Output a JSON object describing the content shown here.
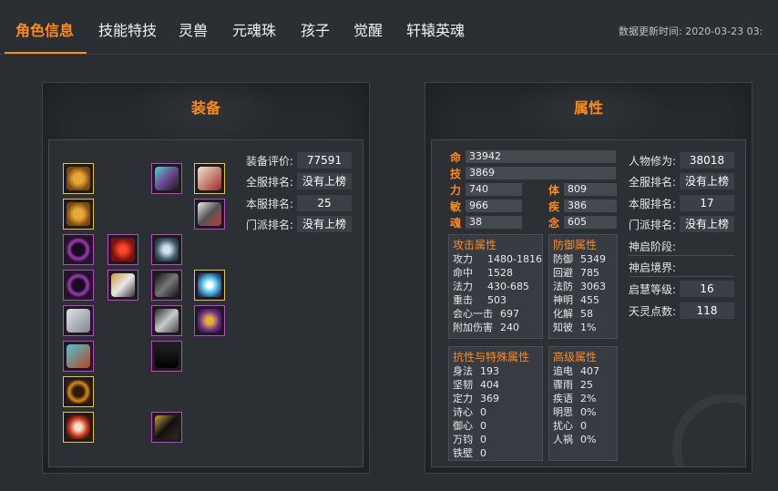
{
  "nav": {
    "tabs": [
      {
        "label": "角色信息",
        "active": true
      },
      {
        "label": "技能特技"
      },
      {
        "label": "灵兽"
      },
      {
        "label": "元魂珠"
      },
      {
        "label": "孩子"
      },
      {
        "label": "觉醒"
      },
      {
        "label": "轩辕英魂"
      }
    ],
    "update_time": "数据更新时间: 2020-03-23 03:"
  },
  "equipment": {
    "title": "装备",
    "stats": [
      {
        "label": "装备评价:",
        "value": "77591"
      },
      {
        "label": "全服排名:",
        "value": "没有上榜"
      },
      {
        "label": "本服排名:",
        "value": "25"
      },
      {
        "label": "门派排名:",
        "value": "没有上榜"
      }
    ],
    "colors": {
      "accent": "#ff8a1e",
      "gold_border": "#e2c547",
      "purple_border": "#b44bc0"
    }
  },
  "attributes": {
    "title": "属性",
    "base": [
      {
        "label": "命",
        "value": "33942"
      },
      {
        "label": "技",
        "value": "3869"
      },
      {
        "label": "力",
        "value": "740"
      },
      {
        "label": "体",
        "value": "809"
      },
      {
        "label": "敏",
        "value": "966"
      },
      {
        "label": "疾",
        "value": "386"
      },
      {
        "label": "魂",
        "value": "38"
      },
      {
        "label": "念",
        "value": "605"
      }
    ],
    "attack": {
      "title": "攻击属性",
      "rows": [
        {
          "k": "攻力",
          "v": "1480-1816"
        },
        {
          "k": "命中",
          "v": "1528"
        },
        {
          "k": "法力",
          "v": "430-685"
        },
        {
          "k": "重击",
          "v": "503"
        },
        {
          "k": "会心一击",
          "v": "697"
        },
        {
          "k": "附加伤害",
          "v": "240"
        }
      ]
    },
    "defense": {
      "title": "防御属性",
      "rows": [
        {
          "k": "防御",
          "v": "5349"
        },
        {
          "k": "回避",
          "v": "785"
        },
        {
          "k": "法防",
          "v": "3063"
        },
        {
          "k": "神明",
          "v": "455"
        },
        {
          "k": "化解",
          "v": "58"
        },
        {
          "k": "知彼",
          "v": "1%"
        }
      ]
    },
    "resist": {
      "title": "抗性与特殊属性",
      "rows": [
        {
          "k": "身法",
          "v": "193"
        },
        {
          "k": "坚韧",
          "v": "404"
        },
        {
          "k": "定力",
          "v": "369"
        },
        {
          "k": "诗心",
          "v": "0"
        },
        {
          "k": "御心",
          "v": "0"
        },
        {
          "k": "万钧",
          "v": "0"
        },
        {
          "k": "铁壁",
          "v": "0"
        }
      ]
    },
    "advanced": {
      "title": "高级属性",
      "rows": [
        {
          "k": "追电",
          "v": "407"
        },
        {
          "k": "骤雨",
          "v": "25"
        },
        {
          "k": "疾语",
          "v": "2%"
        },
        {
          "k": "明思",
          "v": "0%"
        },
        {
          "k": "扰心",
          "v": "0"
        },
        {
          "k": "人祸",
          "v": "0%"
        }
      ]
    },
    "right": [
      {
        "label": "人物修为:",
        "value": "38018"
      },
      {
        "label": "全服排名:",
        "value": "没有上榜"
      },
      {
        "label": "本服排名:",
        "value": "17"
      },
      {
        "label": "门派排名:",
        "value": "没有上榜"
      },
      {
        "label": "神启阶段:",
        "value": ""
      },
      {
        "label": "神启境界:",
        "value": ""
      },
      {
        "label": "启慧等级:",
        "value": "16"
      },
      {
        "label": "天灵点数:",
        "value": "118"
      }
    ]
  }
}
